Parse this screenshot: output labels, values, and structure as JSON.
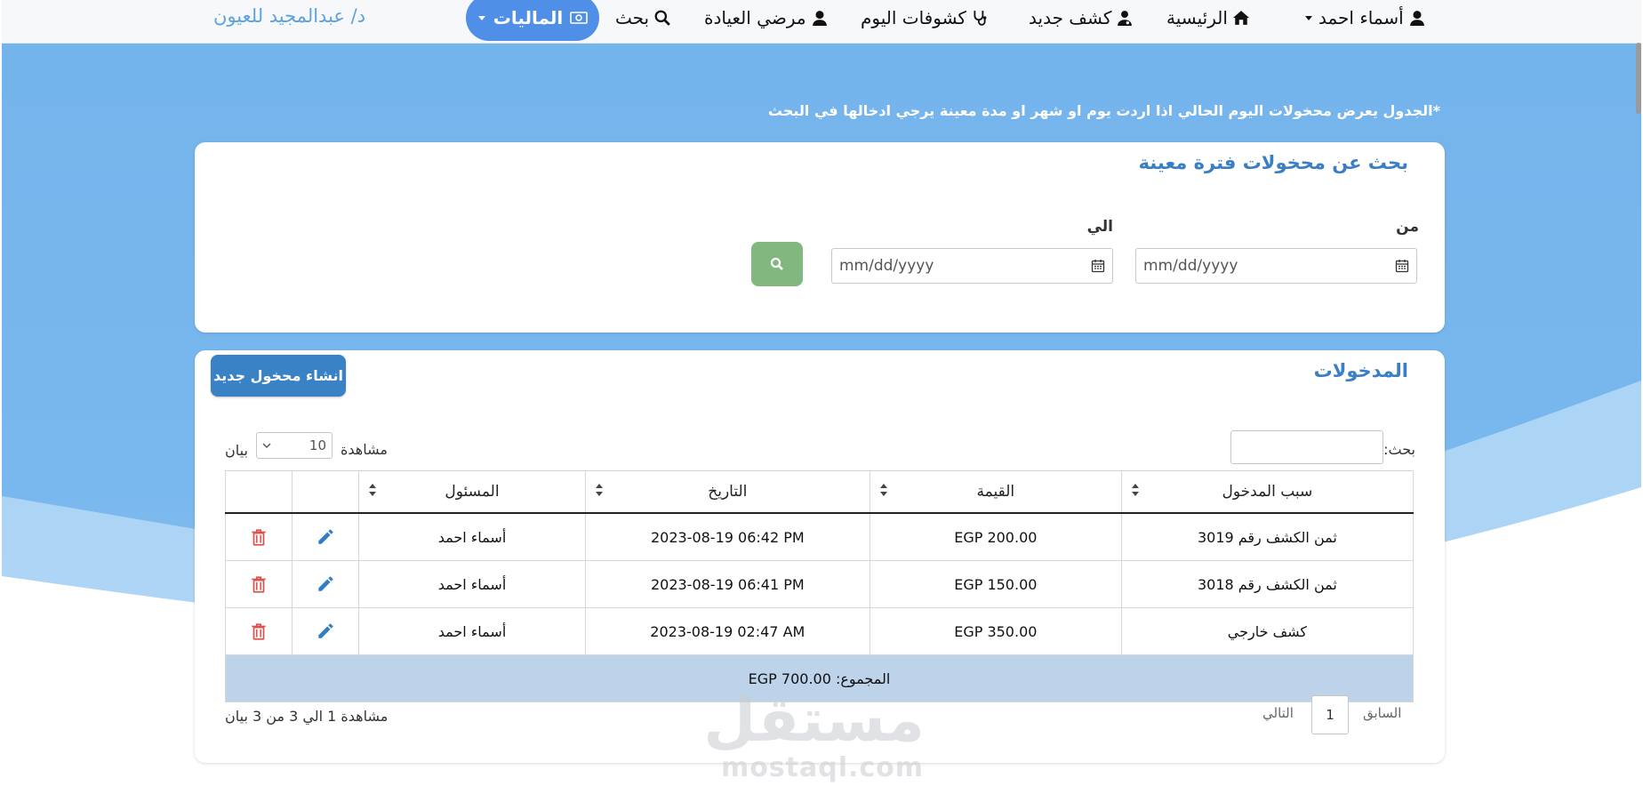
{
  "nav": {
    "user": "أسماء احمد",
    "home": "الرئيسية",
    "new_exam": "كشف جديد",
    "today_exams": "كشوفات اليوم",
    "clinic_patients": "مرضي العيادة",
    "search": "بحث",
    "finance": "الماليات",
    "brand": "د/ عبدالمجيد للعيون"
  },
  "note": "*الجدول يعرض محخولات اليوم الحالي اذا اردت يوم او شهر او مدة معينة يرجي ادخالها في البحث",
  "period_search": {
    "title": "بحث عن محخولات فترة معينة",
    "from_label": "من",
    "to_label": "الي",
    "from_placeholder": "mm/dd/yyyy",
    "to_placeholder": "mm/dd/yyyy"
  },
  "income": {
    "title": "المدخولات",
    "new_button": "انشاء محخول جديد",
    "filter_label": "بحث:",
    "show_label": "مشاهدة",
    "page_length": "10",
    "entries_label": "بيان",
    "columns": [
      "سبب المدخول",
      "القيمة",
      "التاريخ",
      "المسئول"
    ],
    "rows": [
      {
        "reason": "ثمن الكشف رقم 3019",
        "value": "EGP 200.00",
        "date": "2023-08-19 06:42 PM",
        "owner": "أسماء احمد"
      },
      {
        "reason": "ثمن الكشف رقم 3018",
        "value": "EGP 150.00",
        "date": "2023-08-19 06:41 PM",
        "owner": "أسماء احمد"
      },
      {
        "reason": "كشف خارجي",
        "value": "EGP 350.00",
        "date": "2023-08-19 02:47 AM",
        "owner": "أسماء احمد"
      }
    ],
    "total": "المجموع: EGP 700.00",
    "info": "مشاهدة 1 الي 3 من 3 بيان",
    "prev": "السابق",
    "page": "1",
    "next": "التالي"
  },
  "watermark": {
    "ar": "مستقل",
    "en": "mostaql.com"
  },
  "colors": {
    "primary": "#3a82c6",
    "pill": "#4f8fe8",
    "search": "#80b87f",
    "delete": "#d9534f",
    "edit": "#2f7dc4"
  }
}
